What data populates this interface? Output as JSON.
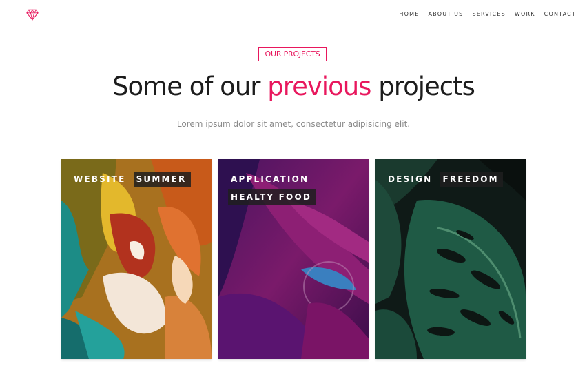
{
  "header": {
    "logo_icon": "diamond-icon",
    "nav": [
      {
        "label": "HOME"
      },
      {
        "label": "ABOUT US"
      },
      {
        "label": "SERVICES"
      },
      {
        "label": "WORK"
      },
      {
        "label": "CONTACT"
      }
    ]
  },
  "section": {
    "badge": "OUR PROJECTS",
    "title_before": "Some of our ",
    "title_accent": "previous",
    "title_after": " projects",
    "subtitle": "Lorem ipsum dolor sit amet, consectetur adipisicing elit."
  },
  "projects": [
    {
      "category": "WEBSITE",
      "name": "SUMMER"
    },
    {
      "category": "APPLICATION",
      "name": "HEALTY FOOD"
    },
    {
      "category": "DESIGN",
      "name": "FREEDOM"
    }
  ],
  "colors": {
    "accent": "#e8175d",
    "text": "#1c1c1c",
    "muted": "#8a8a8a"
  }
}
